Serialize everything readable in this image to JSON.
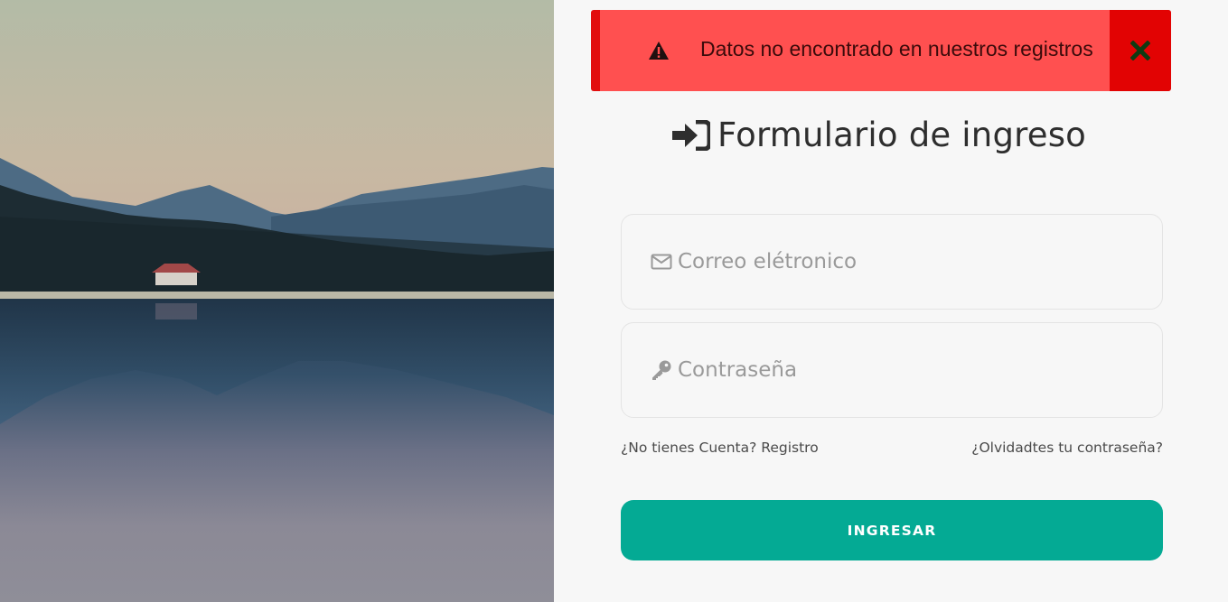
{
  "alert": {
    "message": "Datos no encontrado en nuestros registros",
    "icon": "warning-icon",
    "close_icon": "close-icon",
    "background": "#ff5050",
    "accent": "#e20303"
  },
  "form": {
    "title": "Formulario de ingreso",
    "title_icon": "sign-in-icon",
    "email": {
      "placeholder": "Correo elétronico",
      "value": "",
      "icon": "envelope-icon"
    },
    "password": {
      "placeholder": "Contraseña",
      "value": "",
      "icon": "key-icon"
    },
    "register_link": "¿No tienes Cuenta? Registro",
    "forgot_link": "¿Olvidadtes tu contraseña?",
    "submit_label": "INGRESAR",
    "submit_color": "#04aa94"
  },
  "scene": {
    "image": "mountain-lake-landscape"
  }
}
